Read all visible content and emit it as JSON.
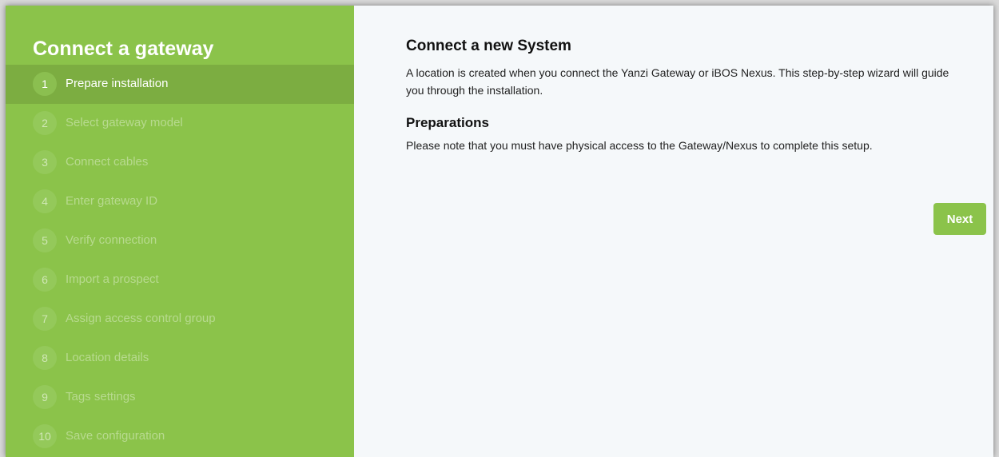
{
  "sidebar": {
    "title": "Connect a gateway",
    "steps": [
      {
        "num": "1",
        "label": "Prepare installation",
        "active": true
      },
      {
        "num": "2",
        "label": "Select gateway model",
        "active": false
      },
      {
        "num": "3",
        "label": "Connect cables",
        "active": false
      },
      {
        "num": "4",
        "label": "Enter gateway ID",
        "active": false
      },
      {
        "num": "5",
        "label": "Verify connection",
        "active": false
      },
      {
        "num": "6",
        "label": "Import a prospect",
        "active": false
      },
      {
        "num": "7",
        "label": "Assign access control group",
        "active": false
      },
      {
        "num": "8",
        "label": "Location details",
        "active": false
      },
      {
        "num": "9",
        "label": "Tags settings",
        "active": false
      },
      {
        "num": "10",
        "label": "Save configuration",
        "active": false
      }
    ]
  },
  "main": {
    "title": "Connect a new System",
    "description": "A location is created when you connect the Yanzi Gateway or iBOS Nexus. This step-by-step wizard will guide you through the installation.",
    "preparations_title": "Preparations",
    "preparations_text": "Please note that you must have physical access to the Gateway/Nexus to complete this setup.",
    "next_label": "Next"
  },
  "colors": {
    "accent": "#8bc34a",
    "active_step": "#7cad41",
    "content_background": "#f5f8fa"
  }
}
